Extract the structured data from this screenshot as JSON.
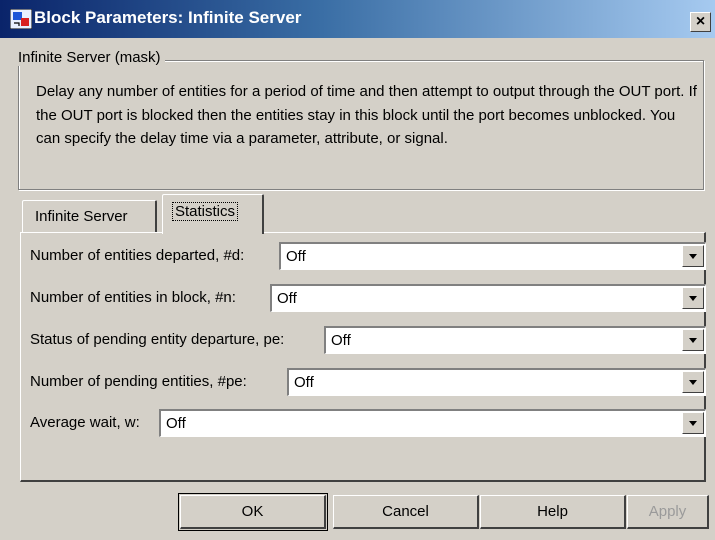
{
  "window": {
    "title": "Block Parameters: Infinite Server",
    "close_symbol": "×",
    "icon": "simulink-block-icon"
  },
  "mask": {
    "legend": "Infinite Server (mask)",
    "description": "Delay any number of entities for a period of time and then attempt to output through the OUT port. If the OUT port is blocked then the entities stay in this block until the port becomes unblocked. You can specify the delay time via a parameter, attribute, or signal."
  },
  "tabs": [
    {
      "label": "Infinite Server",
      "selected": false
    },
    {
      "label": "Statistics",
      "selected": true
    }
  ],
  "parameters": [
    {
      "label": "Number of entities departed, #d:",
      "value": "Off"
    },
    {
      "label": "Number of entities in block, #n:",
      "value": "Off"
    },
    {
      "label": "Status of pending entity departure, pe:",
      "value": "Off"
    },
    {
      "label": "Number of  pending entities, #pe:",
      "value": "Off"
    },
    {
      "label": "Average wait, w:",
      "value": "Off"
    }
  ],
  "buttons": {
    "ok": "OK",
    "cancel": "Cancel",
    "help": "Help",
    "apply": "Apply"
  },
  "colors": {
    "title_gradient_start": "#0a246a",
    "title_gradient_end": "#a6caf0",
    "face": "#d4d0c8",
    "disabled_text": "#9a9a9a"
  }
}
